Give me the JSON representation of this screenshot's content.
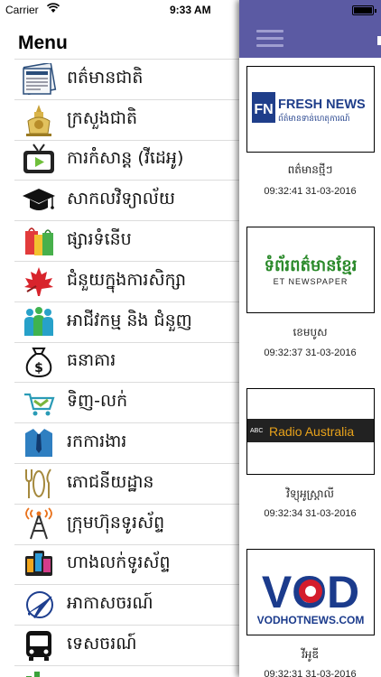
{
  "status_bar": {
    "carrier": "Carrier",
    "time": "9:33 AM"
  },
  "menu": {
    "title": "Menu",
    "items": [
      {
        "label": "ពត៌មានជាតិ",
        "icon": "newspaper-icon"
      },
      {
        "label": "ក្រសួងជាតិ",
        "icon": "royal-emblem-icon"
      },
      {
        "label": "ការកំសាន្ត (វីដេអូ)",
        "icon": "tv-video-icon"
      },
      {
        "label": "សាកលវិទ្យាល័យ",
        "icon": "graduation-cap-icon"
      },
      {
        "label": "ផ្សារទំនើប",
        "icon": "shopping-bags-icon"
      },
      {
        "label": "ជំនួយក្នុងការសិក្សា",
        "icon": "maple-leaf-icon"
      },
      {
        "label": "អាជីវកម្ម និង ជំនួញ",
        "icon": "business-people-icon"
      },
      {
        "label": "ធនាគារ",
        "icon": "money-bag-icon"
      },
      {
        "label": "ទិញ-លក់",
        "icon": "handshake-cart-icon"
      },
      {
        "label": "រកការងារ",
        "icon": "shirt-tie-icon"
      },
      {
        "label": "ភោជនីយដ្ឋាន",
        "icon": "restaurant-icon"
      },
      {
        "label": "ក្រុមហ៊ុនទូរស័ព្ទ",
        "icon": "telecom-tower-icon"
      },
      {
        "label": "ហាងលក់ទូរស័ព្ទ",
        "icon": "mobile-phones-icon"
      },
      {
        "label": "អាកាសចរណ៍",
        "icon": "airplane-icon"
      },
      {
        "label": "ទេសចរណ៍",
        "icon": "bus-icon"
      }
    ]
  },
  "feed": {
    "items": [
      {
        "name": "ពត៌មានថ្មីៗ",
        "time": "09:32:41 31-03-2016",
        "logo_text": "FRESH NEWS",
        "logo_sub": "ព័ត៌មានទាន់ហេតុការណ៍",
        "logo_mark": "FN"
      },
      {
        "name": "ខេមបូស",
        "time": "09:32:37 31-03-2016",
        "logo_text": "ទំព័រពត៌មានខ្មែរ",
        "logo_sub": "ET NEWSPAPER"
      },
      {
        "name": "វិទ្យុអូស្ត្រាលី",
        "time": "09:32:34 31-03-2016",
        "logo_text": "Radio Australia",
        "logo_mark": "ABC"
      },
      {
        "name": "វីអូឌី",
        "time": "09:32:31 31-03-2016",
        "logo_text": "VOD",
        "logo_sub": "VODHOTNEWS.COM"
      }
    ]
  },
  "colors": {
    "navbar": "#5b5aa3",
    "fresh_blue": "#1f3e8a",
    "ko_green": "#2b8a2b",
    "radio_orange": "#e8a21b",
    "vod_blue": "#1b3b8c",
    "vod_red": "#d41d2c"
  }
}
